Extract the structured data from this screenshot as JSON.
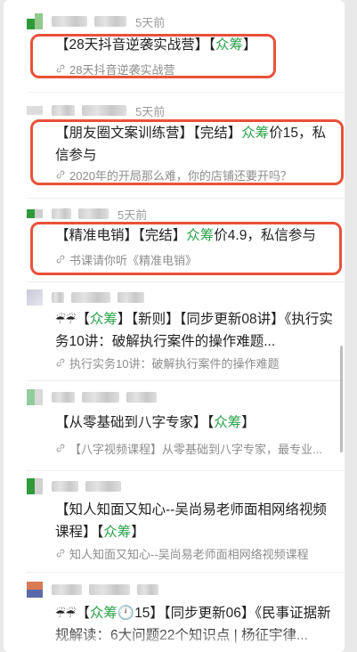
{
  "posts": [
    {
      "time": "5天前",
      "title_parts": [
        "【28天抖音逆袭实战营】【",
        "众筹",
        "】"
      ],
      "source": "28天抖音逆袭实战营"
    },
    {
      "time": "5天前",
      "title_parts": [
        "【朋友圈文案训练营】【完结】",
        "众筹",
        "价15，私信参与"
      ],
      "source": "2020年的开局那么难，你的店铺还要开吗？"
    },
    {
      "time": "5天前",
      "title_parts": [
        "【精准电销】【完结】",
        "众筹",
        "价4.9，私信参与"
      ],
      "source": "书课请你听《精准电销》"
    },
    {
      "emoji": "☔☔",
      "title_parts": [
        "【",
        "众筹",
        "】【新则】【同步更新08讲】《执行实务10讲：破解执行案件的操作难题..."
      ],
      "source": "执行实务10讲：破解执行案件的操作难题"
    },
    {
      "title_parts": [
        "【从零基础到八字专家】【",
        "众筹",
        "】"
      ],
      "source": "【八字视频课程】从零基础到八字专家，最专业..."
    },
    {
      "title_parts": [
        "【知人知面又知心--吴尚易老师面相网络视频课程】【",
        "众筹",
        "】"
      ],
      "source": "知人知面又知心--吴尚易老师面相网络视频课程"
    },
    {
      "emoji": "☔☔",
      "title_parts": [
        "【",
        "众筹",
        "🕛15】【同步更新06】《民事证据新规解读：6大问题22个知识点 | 杨征宇律..."
      ],
      "source": ""
    }
  ],
  "colors": {
    "highlight": "#e9513a",
    "accent": "#2aa34a"
  },
  "icons": {
    "source": "link-icon"
  }
}
